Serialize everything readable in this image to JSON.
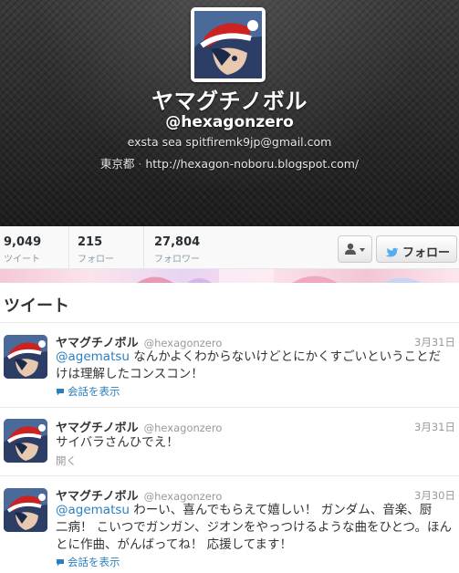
{
  "profile": {
    "name": "ヤマグチノボル",
    "handle": "@hexagonzero",
    "bio": "exsta sea  spitfiremk9jp@gmail.com",
    "location": "東京都",
    "separator": "·",
    "url": "http://hexagon-noboru.blogspot.com/"
  },
  "stats": [
    {
      "value": "9,049",
      "label": "ツイート"
    },
    {
      "value": "215",
      "label": "フォロー"
    },
    {
      "value": "27,804",
      "label": "フォロワー"
    }
  ],
  "actions": {
    "user_menu_icon": "user-dropdown-icon",
    "follow_label": "フォロー"
  },
  "timeline": {
    "heading": "ツイート",
    "tweets": [
      {
        "name": "ヤマグチノボル",
        "handle": "@hexagonzero",
        "date": "3月31日",
        "mention": "@agematsu",
        "text_line1": " なんかよくわからないけどとにかくすごいということだ",
        "text_line2": "けは理解したコンスコン！",
        "action": "会話を表示"
      },
      {
        "name": "ヤマグチノボル",
        "handle": "@hexagonzero",
        "date": "3月31日",
        "text_line1": "サイバラさんひでえ！",
        "action": "開く"
      },
      {
        "name": "ヤマグチノボル",
        "handle": "@hexagonzero",
        "date": "3月30日",
        "mention": "@agematsu",
        "text_line1": " わーい、喜んでもらえて嬉しい！ ガンダム、音楽、厨",
        "text_line2": "二病！ こいつでガンガン、ジオンをやっつけるような曲をひとつ。ほん",
        "text_line3": "とに作曲、がんばってね！ 応援してます！",
        "action": "会話を表示"
      }
    ]
  },
  "colors": {
    "link": "#2a7fc1",
    "twitter_blue": "#55acee",
    "muted": "#999999"
  }
}
